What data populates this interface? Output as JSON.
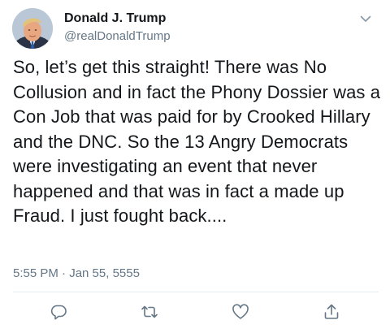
{
  "tweet": {
    "display_name": "Donald J. Trump",
    "handle": "@realDonaldTrump",
    "text": "So, let’s get this straight! There was No Collusion and in fact the Phony Dossier was a Con Job that was paid for by Crooked Hillary and the DNC. So the 13 Angry Democrats were investigating an event that never happened and that was in fact a made up Fraud. I just fought back....",
    "timestamp": "5:55 PM · Jan 55, 5555"
  },
  "icons": {
    "menu": "chevron-down-icon",
    "reply": "reply-icon",
    "retweet": "retweet-icon",
    "like": "heart-icon",
    "share": "share-icon"
  },
  "colors": {
    "text": "#14171a",
    "secondary": "#657786",
    "divider": "#e6ecf0",
    "icon": "#657786"
  }
}
